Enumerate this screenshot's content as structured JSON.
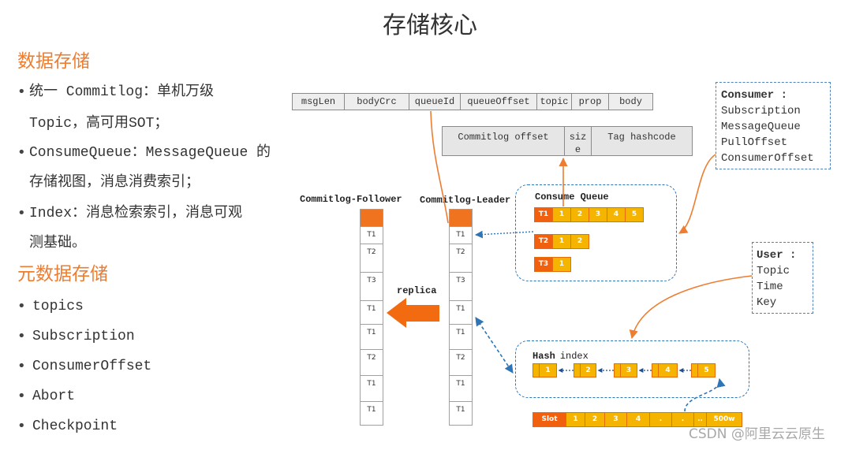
{
  "title": "存储核心",
  "watermark": "CSDN @阿里云云原生",
  "bullet_glyph": "•",
  "colors": {
    "heading_orange": "#ed7d31",
    "log_orange": "#f07320",
    "cell_yellow": "#f5b400",
    "cell_red": "#f0600f",
    "cell_border": "#e46c0a",
    "connector_orange": "#ed7d31",
    "connector_blue": "#2e75b6",
    "arrow_orange": "#f26b10"
  },
  "data_storage": {
    "heading": "数据存储",
    "bullets": [
      {
        "line1": "统一 Commitlog：单机万级",
        "line2": "Topic，高可用SOT；"
      },
      {
        "line1": "ConsumeQueue：MessageQueue 的",
        "line2": "存储视图，消息消费索引；"
      },
      {
        "line1": "Index：消息检索索引，消息可观",
        "line2": "测基础。"
      }
    ]
  },
  "metadata_storage": {
    "heading": "元数据存储",
    "bullets": [
      "topics",
      "Subscription",
      "ConsumerOffset",
      "Abort",
      "Checkpoint"
    ]
  },
  "diagram": {
    "message_fields": [
      "msgLen",
      "bodyCrc",
      "queueId",
      "queueOffset",
      "topic",
      "prop",
      "body"
    ],
    "consume_queue_entry": [
      "Commitlog offset",
      "size",
      "Tag hashcode"
    ],
    "consumer_box": {
      "title": "Consumer :",
      "items": [
        "Subscription",
        "MessageQueue",
        "PullOffset",
        "ConsumerOffset"
      ]
    },
    "user_box": {
      "title": "User :",
      "items": [
        "Topic",
        "Time",
        "Key"
      ]
    },
    "follower": {
      "label": "Commitlog-Follower",
      "cells": [
        "T1",
        "T2",
        "T3",
        "T1",
        "T1",
        "T2",
        "T1",
        "T1"
      ]
    },
    "leader": {
      "label": "Commitlog-Leader",
      "cells": [
        "T1",
        "T2",
        "T3",
        "T1",
        "T1",
        "T2",
        "T1",
        "T1"
      ]
    },
    "replica_label": "replica",
    "consume_queue": {
      "label": "Consume Queue",
      "rows": [
        {
          "topic": "T1",
          "entries": [
            "1",
            "2",
            "3",
            "4",
            "5"
          ]
        },
        {
          "topic": "T2",
          "entries": [
            "1",
            "2"
          ]
        },
        {
          "topic": "T3",
          "entries": [
            "1"
          ]
        }
      ]
    },
    "hash_index": {
      "label_bold": "Hash",
      "label_rest": "index",
      "entries": [
        "1",
        "2",
        "3",
        "4",
        "5"
      ]
    },
    "slot_row": {
      "label": "Slot",
      "cells": [
        "1",
        "2",
        "3",
        "4",
        ".",
        ".",
        "..",
        "500w"
      ]
    }
  }
}
